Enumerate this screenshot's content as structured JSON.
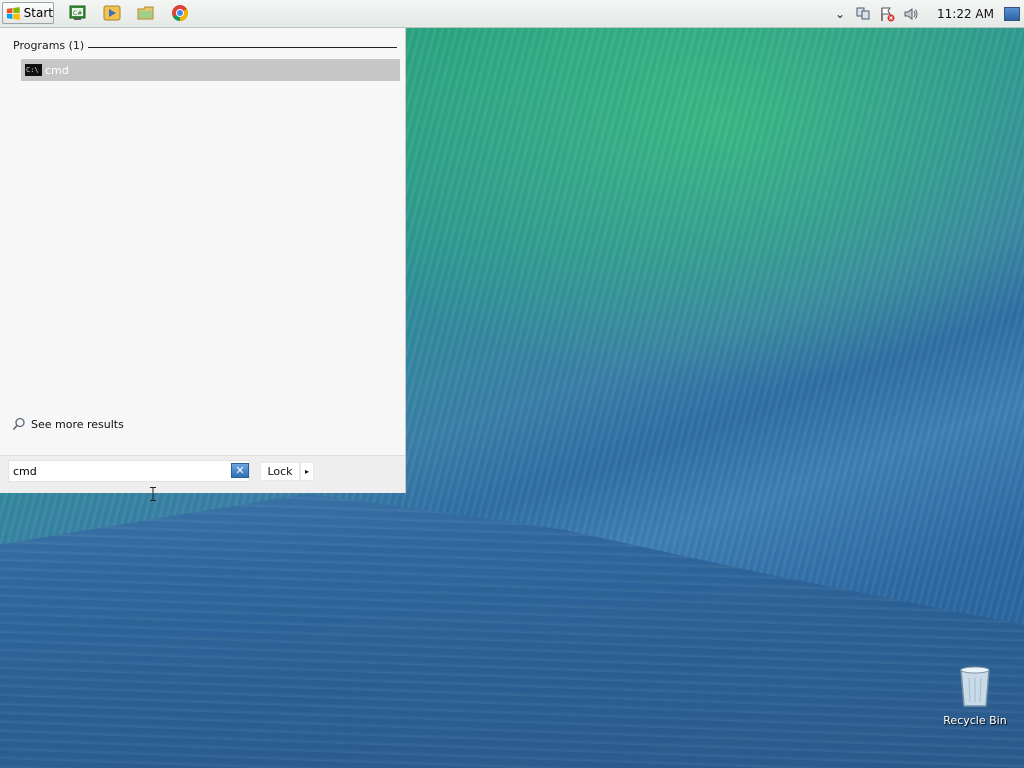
{
  "taskbar": {
    "start_label": "Start",
    "pinned": [
      {
        "name": "csharp-app-icon",
        "glyph": "C#"
      },
      {
        "name": "media-player-icon",
        "glyph": "▶"
      },
      {
        "name": "file-explorer-icon",
        "glyph": ""
      },
      {
        "name": "chrome-icon",
        "glyph": ""
      }
    ],
    "tray": {
      "overflow_glyph": "⌄",
      "clock": "11:22 AM"
    }
  },
  "start_menu": {
    "programs_header": "Programs (1)",
    "results": [
      {
        "label": "cmd",
        "icon": "C:\\"
      }
    ],
    "see_more_label": "See more results",
    "search": {
      "value": "cmd",
      "clear_glyph": "✕"
    },
    "power": {
      "lock_label": "Lock",
      "arrow_glyph": "▸"
    }
  },
  "desktop": {
    "recycle_bin_label": "Recycle Bin"
  }
}
